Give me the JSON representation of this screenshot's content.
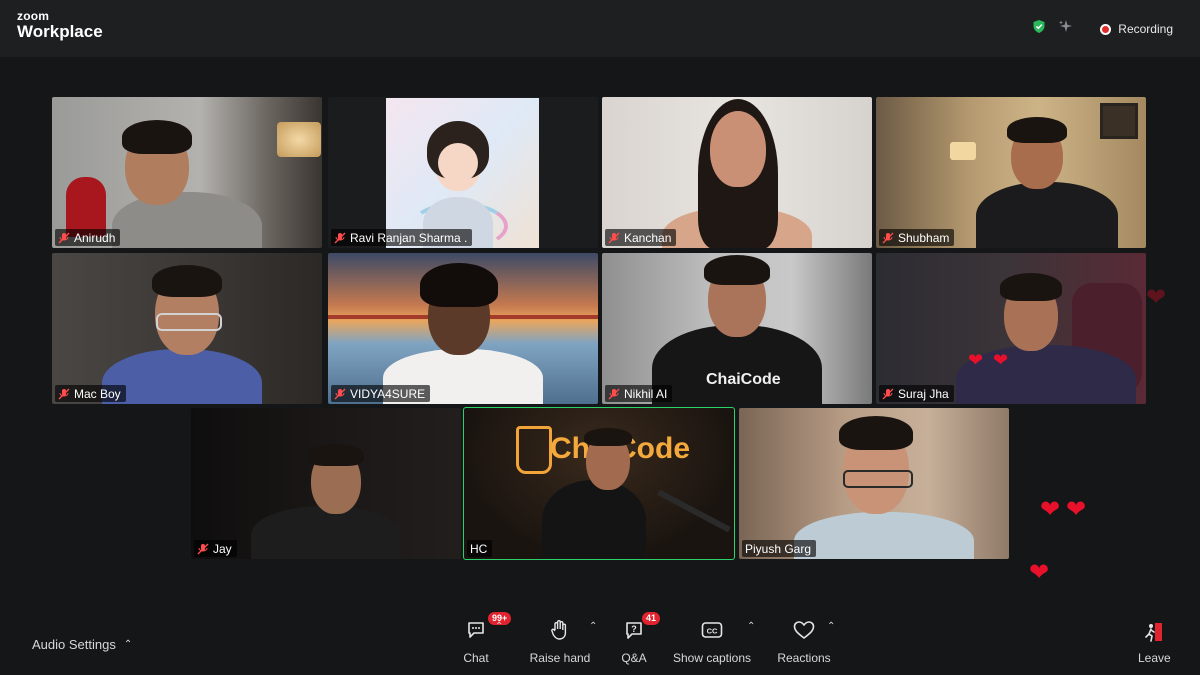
{
  "app": {
    "brand_small": "zoom",
    "brand_large": "Workplace"
  },
  "status": {
    "recording_label": "Recording",
    "shield_color": "#2bb85c"
  },
  "participants": [
    {
      "name": "Anirudh",
      "muted": true
    },
    {
      "name": "Ravi Ranjan Sharma .",
      "muted": true
    },
    {
      "name": "Kanchan",
      "muted": true
    },
    {
      "name": "Shubham",
      "muted": true
    },
    {
      "name": "Mac Boy",
      "muted": true
    },
    {
      "name": "VIDYA4SURE",
      "muted": true
    },
    {
      "name": "Nikhil AI",
      "muted": true
    },
    {
      "name": "Suraj Jha",
      "muted": true
    },
    {
      "name": "Jay",
      "muted": true
    },
    {
      "name": "HC",
      "muted": false,
      "active_speaker": true,
      "background_text": "ChaiCode"
    },
    {
      "name": "Piyush Garg",
      "muted": false
    }
  ],
  "toolbar": {
    "audio_settings": "Audio Settings",
    "chat": {
      "label": "Chat",
      "badge": "99+"
    },
    "raise_hand": {
      "label": "Raise hand"
    },
    "qa": {
      "label": "Q&A",
      "badge": "41"
    },
    "captions": {
      "label": "Show captions"
    },
    "reactions": {
      "label": "Reactions"
    },
    "leave": {
      "label": "Leave"
    }
  },
  "colors": {
    "active_border": "#2bd26a",
    "badge": "#e0232e",
    "heart": "#e8102a",
    "leave": "#e0232e"
  }
}
